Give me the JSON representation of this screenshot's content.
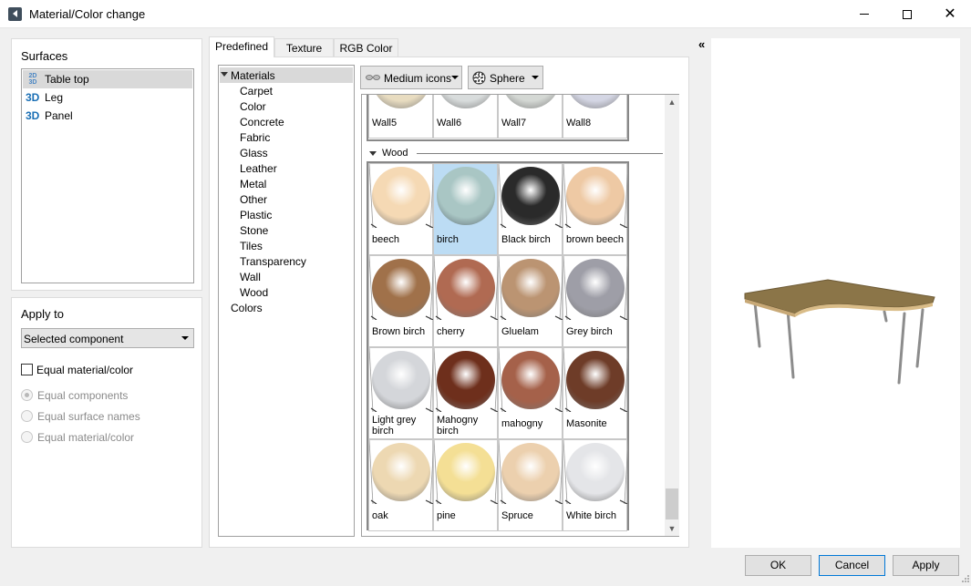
{
  "window": {
    "title": "Material/Color change"
  },
  "surfaces": {
    "title": "Surfaces",
    "items": [
      {
        "icon": "2d-3d-icon",
        "icon_text_top": "2D",
        "icon_text_bottom": "3D",
        "label": "Table top",
        "selected": true
      },
      {
        "icon": "3d-icon",
        "icon_text": "3D",
        "label": "Leg"
      },
      {
        "icon": "3d-icon",
        "icon_text": "3D",
        "label": "Panel"
      }
    ]
  },
  "apply_to": {
    "title": "Apply to",
    "selected": "Selected component",
    "equal_checkbox": "Equal material/color",
    "radios": [
      "Equal components",
      "Equal surface names",
      "Equal material/color"
    ]
  },
  "tabs": [
    "Predefined",
    "Texture",
    "RGB Color"
  ],
  "tree": {
    "root": "Materials",
    "children": [
      "Carpet",
      "Color",
      "Concrete",
      "Fabric",
      "Glass",
      "Leather",
      "Metal",
      "Other",
      "Plastic",
      "Stone",
      "Tiles",
      "Transparency",
      "Wall",
      "Wood"
    ],
    "colors": "Colors"
  },
  "toolbar": {
    "view_mode": "Medium icons",
    "preview_shape": "Sphere"
  },
  "wall_group": [
    "Wall5",
    "Wall6",
    "Wall7",
    "Wall8"
  ],
  "wood_group": {
    "name": "Wood",
    "items": [
      {
        "l1": "beech",
        "l2": "",
        "color": "#f5d9b4",
        "selected": false
      },
      {
        "l1": "birch",
        "l2": "",
        "color": "#a9c6c4",
        "selected": true
      },
      {
        "l1": "Black birch",
        "l2": "",
        "color": "#2a2a2a",
        "selected": false
      },
      {
        "l1": "brown beech",
        "l2": "",
        "color": "#eec9a4",
        "selected": false
      },
      {
        "l1": "Brown birch",
        "l2": "",
        "color": "#a0714a",
        "selected": false
      },
      {
        "l1": "cherry",
        "l2": "",
        "color": "#b06a52",
        "selected": false
      },
      {
        "l1": "Gluelam",
        "l2": "",
        "color": "#bb9472",
        "selected": false
      },
      {
        "l1": "Grey birch",
        "l2": "",
        "color": "#9e9ea7",
        "selected": false
      },
      {
        "l1": "Light grey",
        "l2": "birch",
        "color": "#d4d6da",
        "selected": false
      },
      {
        "l1": "Mahogny",
        "l2": "birch",
        "color": "#6e2f1c",
        "selected": false
      },
      {
        "l1": "mahogny",
        "l2": "",
        "color": "#a5614a",
        "selected": false
      },
      {
        "l1": "Masonite",
        "l2": "",
        "color": "#6e3c28",
        "selected": false
      },
      {
        "l1": "oak",
        "l2": "",
        "color": "#edd8b2",
        "selected": false
      },
      {
        "l1": "pine",
        "l2": "",
        "color": "#f4df95",
        "selected": false
      },
      {
        "l1": "Spruce",
        "l2": "",
        "color": "#ecd0ae",
        "selected": false
      },
      {
        "l1": "White birch",
        "l2": "",
        "color": "#e4e5e8",
        "selected": false
      }
    ]
  },
  "collapse_label": "«",
  "buttons": {
    "ok": "OK",
    "cancel": "Cancel",
    "apply": "Apply"
  }
}
